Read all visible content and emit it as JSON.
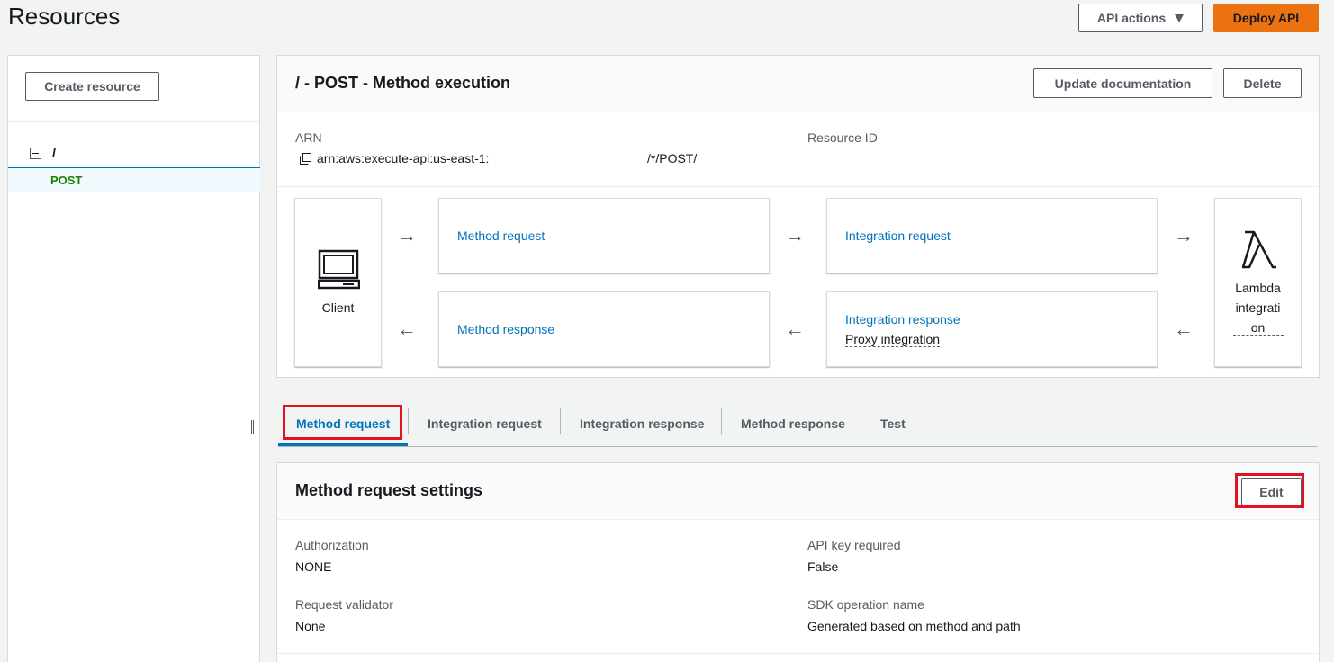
{
  "page": {
    "title": "Resources"
  },
  "top_actions": {
    "api_actions": "API actions",
    "deploy_api": "Deploy API"
  },
  "left_panel": {
    "create_resource": "Create resource",
    "tree": {
      "root": "/",
      "method": "POST"
    }
  },
  "method_execution": {
    "title": "/ - POST - Method execution",
    "update_documentation": "Update documentation",
    "delete": "Delete",
    "arn_label": "ARN",
    "arn_value_prefix": "arn:aws:execute-api:us-east-1:",
    "arn_value_suffix": "/*/POST/",
    "resource_id_label": "Resource ID",
    "flow": {
      "client": "Client",
      "method_request": "Method request",
      "method_response": "Method response",
      "integration_request": "Integration request",
      "integration_response": "Integration response",
      "proxy_integration": "Proxy integration",
      "lambda_line1": "Lambda",
      "lambda_line2": "integrati",
      "lambda_line3": "on"
    }
  },
  "tabs": [
    "Method request",
    "Integration request",
    "Integration response",
    "Method response",
    "Test"
  ],
  "method_request_settings": {
    "title": "Method request settings",
    "edit": "Edit",
    "authorization_label": "Authorization",
    "authorization_value": "NONE",
    "api_key_label": "API key required",
    "api_key_value": "False",
    "request_validator_label": "Request validator",
    "request_validator_value": "None",
    "sdk_operation_label": "SDK operation name",
    "sdk_operation_value": "Generated based on method and path"
  },
  "colors": {
    "accent": "#0073bb",
    "primary_button": "#ec7211",
    "highlight_box": "#e0141e",
    "method_green": "#1d8102"
  }
}
